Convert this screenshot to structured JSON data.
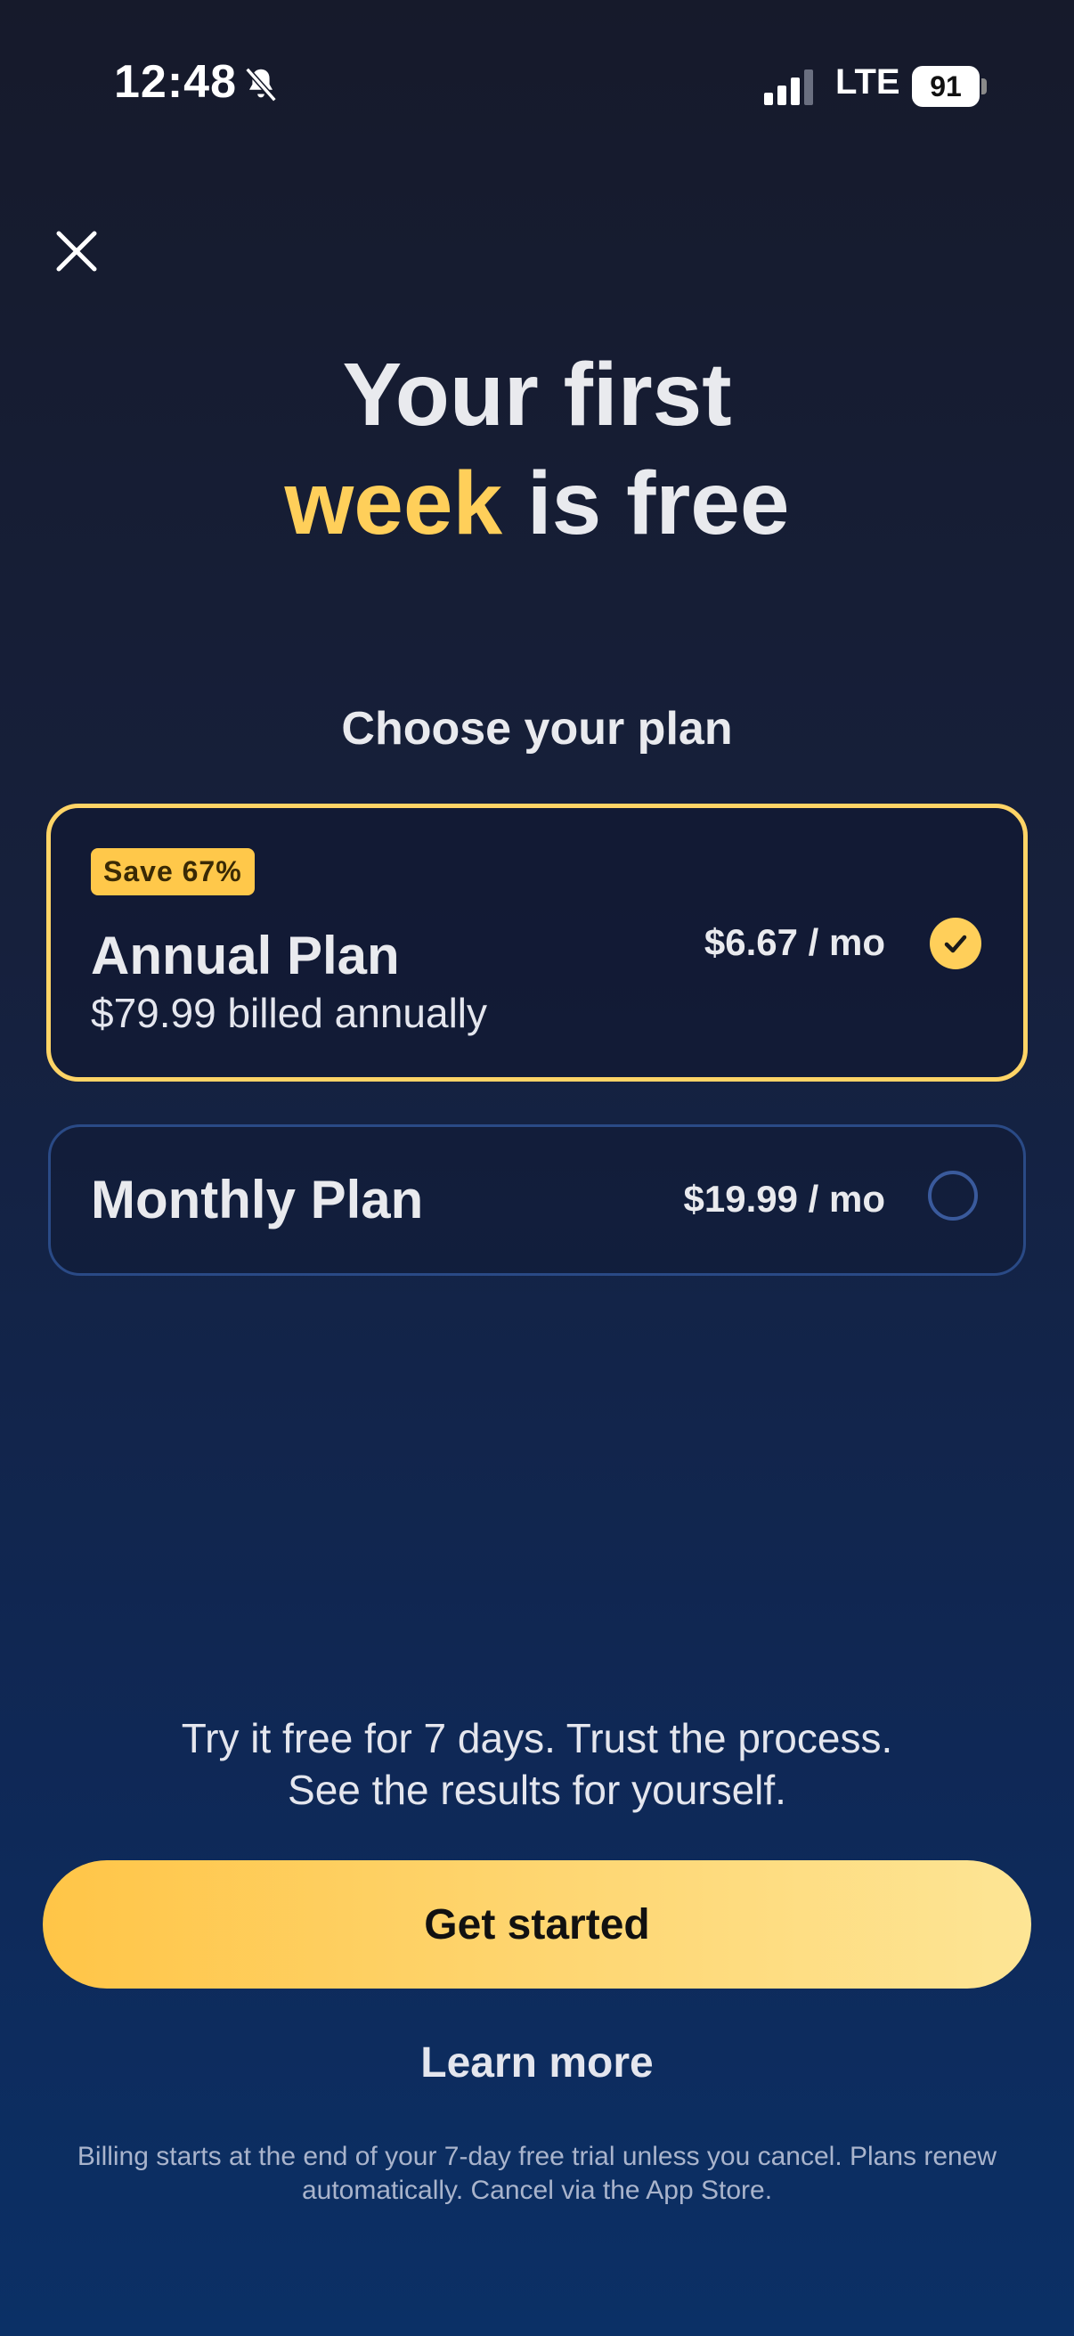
{
  "status_bar": {
    "time": "12:48",
    "network": "LTE",
    "battery": "91"
  },
  "headline": {
    "line1": "Your first",
    "line2_accent": "week",
    "line2_rest": " is free"
  },
  "subheading": "Choose your plan",
  "plans": [
    {
      "badge": "Save 67%",
      "title": "Annual Plan",
      "subtitle": "$79.99 billed annually",
      "price": "$6.67 / mo",
      "selected": true
    },
    {
      "title": "Monthly Plan",
      "price": "$19.99 / mo",
      "selected": false
    }
  ],
  "promo": {
    "line1": "Try it free for 7 days. Trust the process.",
    "line2": "See the results for yourself."
  },
  "cta_label": "Get started",
  "learn_more": "Learn more",
  "fineprint": "Billing starts at the end of your 7-day free trial unless you cancel. Plans renew automatically. Cancel via the App Store.",
  "colors": {
    "accent": "#ffcf5a",
    "selected_border": "#ffd466",
    "unselected_border": "#2a4a86"
  }
}
